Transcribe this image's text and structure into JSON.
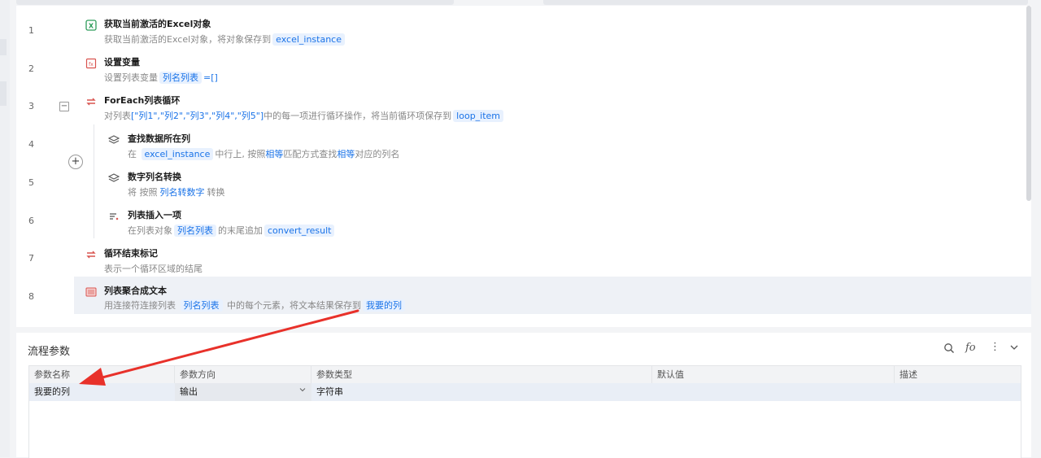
{
  "steps": [
    {
      "line": "1",
      "title": "获取当前激活的Excel对象",
      "desc_prefix": "获取当前激活的Excel对象，将对象保存到",
      "chip1": "excel_instance",
      "icon": "excel-icon"
    },
    {
      "line": "2",
      "title": "设置变量",
      "desc_prefix": "设置列表变量",
      "chip1": "列名列表",
      "desc_suffix": "=[]",
      "icon": "variable-icon"
    },
    {
      "line": "3",
      "title": "ForEach列表循环",
      "desc_prefix": "对列表",
      "list_literal": "[\"列1\",\"列2\",\"列3\",\"列4\",\"列5\"]",
      "desc_mid": "中的每一项进行循环操作，将当前循环项保存到",
      "chip1": "loop_item",
      "icon": "loop-icon"
    },
    {
      "line": "4",
      "title": "查找数据所在列",
      "desc_prefix": "在",
      "chip1": "excel_instance",
      "desc_mid": "中行上, 按照",
      "hl1": "相等",
      "desc_mid2": "匹配方式查找",
      "hl2": "相等",
      "desc_suffix": "对应的列名",
      "icon": "layers-icon"
    },
    {
      "line": "5",
      "title": "数字列名转换",
      "desc_prefix": "将  按照",
      "chip1": "列名转数字",
      "desc_suffix": "转换",
      "icon": "layers-icon"
    },
    {
      "line": "6",
      "title": "列表插入一项",
      "desc_prefix": "在列表对象",
      "chip1": "列名列表",
      "desc_mid": "的末尾追加",
      "chip2": "convert_result",
      "icon": "list-insert-icon"
    },
    {
      "line": "7",
      "title": "循环结束标记",
      "desc_prefix": "表示一个循环区域的结尾",
      "icon": "loop-end-icon"
    },
    {
      "line": "8",
      "title": "列表聚合成文本",
      "desc_prefix": "用连接符连接列表",
      "chip1": "列名列表",
      "desc_mid": "中的每个元素，将文本结果保存到",
      "chip2": "我要的列",
      "icon": "text-join-icon"
    }
  ],
  "panel": {
    "title": "流程参数",
    "columns": [
      "参数名称",
      "参数方向",
      "参数类型",
      "默认值",
      "描述"
    ],
    "rows": [
      {
        "name": "我要的列",
        "direction": "输出",
        "type": "字符串",
        "default": "",
        "description": ""
      }
    ],
    "fx_label": "fo"
  },
  "colors": {
    "accent": "#1a73e8",
    "arrow": "#e8312a",
    "chip_bg": "#e8f1fe",
    "active_row": "#eef1f6"
  }
}
